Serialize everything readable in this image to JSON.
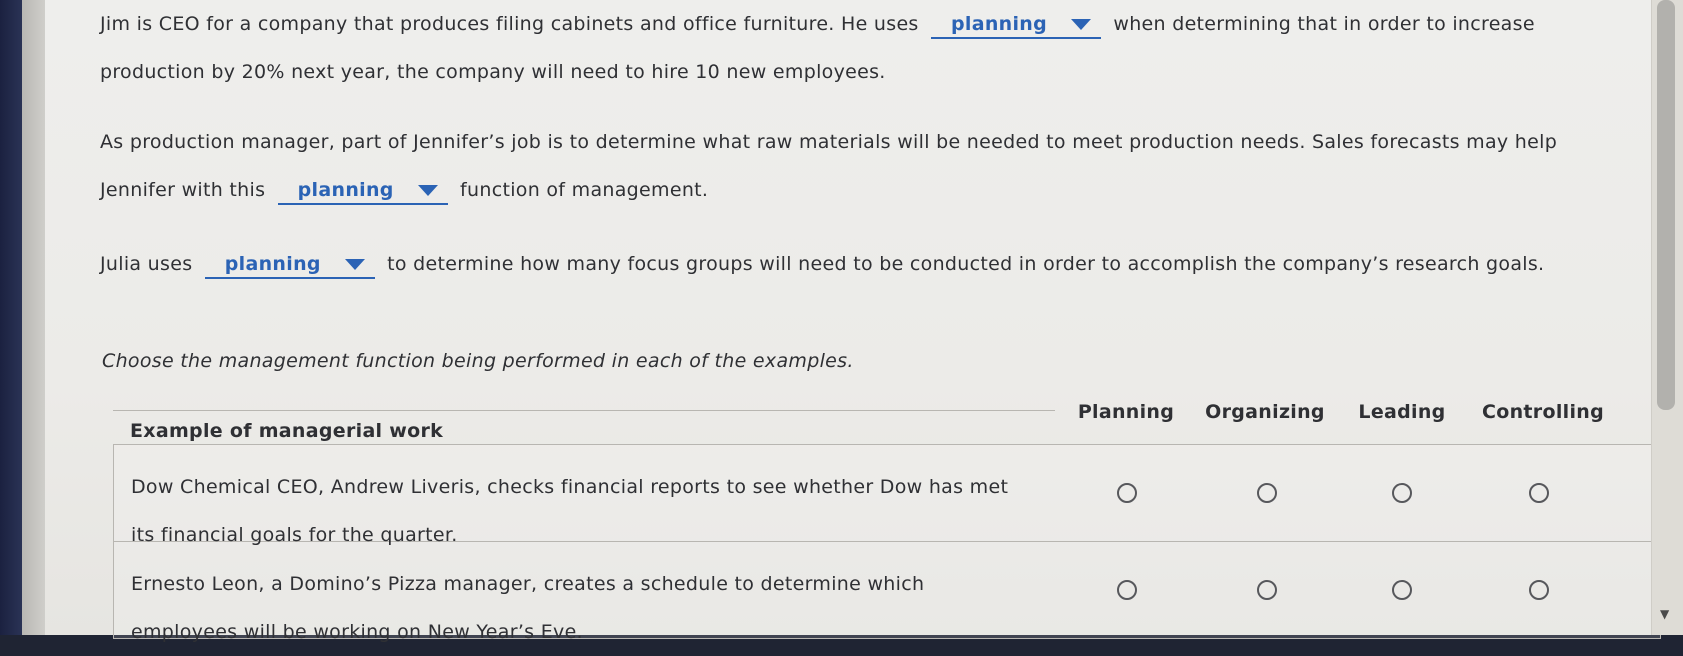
{
  "paragraph1": {
    "text_before": "Jim is CEO for a company that produces filing cabinets and office furniture. He uses",
    "dropdown_value": "planning",
    "text_after": "when determining that in order to increase production by 20% next year, the company will need to hire 10 new employees."
  },
  "paragraph2": {
    "text_before": "As production manager, part of Jennifer’s job is to determine what raw materials will be needed to meet production needs. Sales forecasts may help Jennifer with this",
    "dropdown_value": "planning",
    "text_after": "function of management."
  },
  "paragraph3": {
    "text_before": "Julia uses",
    "dropdown_value": "planning",
    "text_after": "to determine how many focus groups will need to be conducted in order to accomplish the company’s research goals."
  },
  "instruction": "Choose the management function being performed in each of the examples.",
  "table": {
    "example_header": "Example of managerial work",
    "columns": [
      "Planning",
      "Organizing",
      "Leading",
      "Controlling"
    ],
    "rows": [
      {
        "text": "Dow Chemical CEO, Andrew Liveris, checks financial reports to see whether Dow has met its financial goals for the quarter."
      },
      {
        "text": "Ernesto Leon, a Domino’s Pizza manager, creates a schedule to determine which employees will be working on New Year’s Eve."
      }
    ]
  },
  "colors": {
    "accent": "#2b63b5",
    "text": "#2f3034",
    "background": "#eeeeec"
  }
}
